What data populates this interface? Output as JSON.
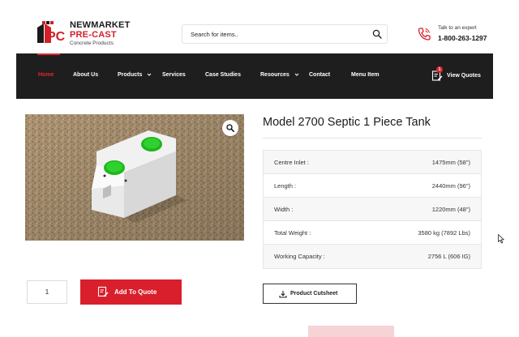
{
  "header": {
    "logo": {
      "mark": "NPC",
      "line1": "NEWMARKET",
      "line2": "PRE-CAST",
      "line3": "Concrete Products"
    },
    "search": {
      "placeholder": "Search for items..",
      "icon": "search-icon"
    },
    "expert": {
      "label": "Talk to an expert",
      "phone": "1-800-263-1297",
      "icon": "phone-icon"
    }
  },
  "nav": {
    "items": [
      {
        "label": "Home",
        "active": true
      },
      {
        "label": "About Us"
      },
      {
        "label": "Products",
        "has_dropdown": true
      },
      {
        "label": "Services"
      },
      {
        "label": "Case Studies"
      },
      {
        "label": "Resources",
        "has_dropdown": true
      },
      {
        "label": "Contact"
      },
      {
        "label": "Menu Item"
      }
    ],
    "quotes": {
      "label": "View Quotes",
      "count": "1"
    }
  },
  "product": {
    "title": "Model 2700 Septic 1 Piece Tank",
    "specs": [
      {
        "label": "Centre Inlet :",
        "value": "1475mm (58\")"
      },
      {
        "label": "Length :",
        "value": "2440mm (96\")"
      },
      {
        "label": "Width :",
        "value": "1220mm (48\")"
      },
      {
        "label": "Total Weight :",
        "value": "3580 kg (7892 Lbs)"
      },
      {
        "label": "Working Capacity :",
        "value": "2756 L (606 IG)"
      }
    ],
    "quantity": "1",
    "add_to_quote": "Add To Quote",
    "cutsheet": "Product Cutsheet"
  },
  "colors": {
    "brand_red": "#d91f2b",
    "nav_bg": "#1e1e1e",
    "lid_green": "#1fb51f"
  }
}
